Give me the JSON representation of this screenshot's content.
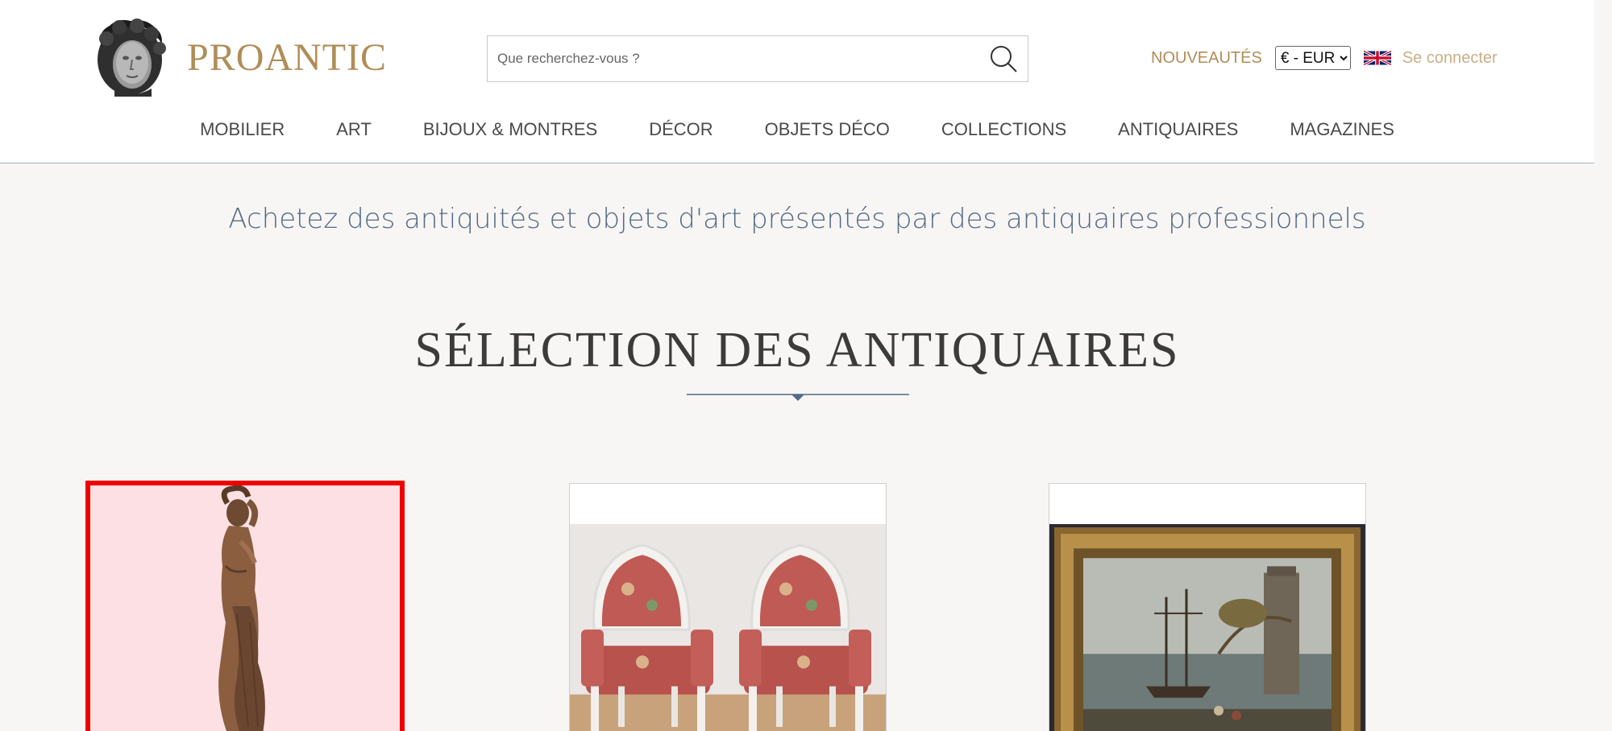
{
  "header": {
    "logo_text": "PROANTIC",
    "search": {
      "placeholder": "Que recherchez-vous ?",
      "value": ""
    },
    "new_link": "NOUVEAUTÉS",
    "currency_selected": "€ - EUR",
    "language_flag": "uk-flag-icon",
    "login_link": "Se connecter"
  },
  "nav": {
    "items": [
      {
        "label": "MOBILIER"
      },
      {
        "label": "ART"
      },
      {
        "label": "BIJOUX & MONTRES"
      },
      {
        "label": "DÉCOR"
      },
      {
        "label": "OBJETS DÉCO"
      },
      {
        "label": "COLLECTIONS"
      },
      {
        "label": "ANTIQUAIRES"
      },
      {
        "label": "MAGAZINES"
      }
    ]
  },
  "main": {
    "tagline": "Achetez des antiquités et objets d'art présentés par des antiquaires professionnels",
    "section_title": "SÉLECTION DES ANTIQUAIRES",
    "products": [
      {
        "image": "bronze-venus-statue-image",
        "selected": true
      },
      {
        "image": "pair-of-louis-xvi-armchairs-image",
        "selected": false
      },
      {
        "image": "framed-marine-painting-image",
        "selected": false
      }
    ]
  },
  "colors": {
    "brand_gold": "#b08d57",
    "tagline_blue": "#566a85",
    "selection_red": "#f00000",
    "background": "#f7f6f4"
  }
}
